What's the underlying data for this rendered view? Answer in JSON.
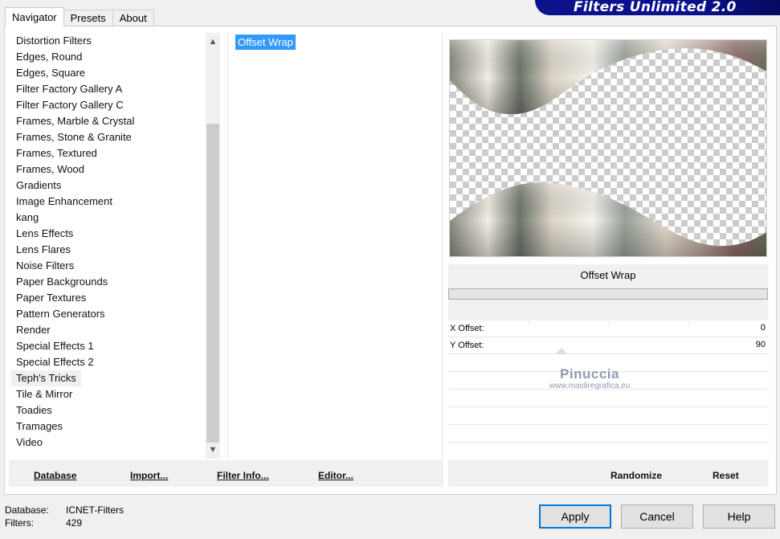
{
  "tabs": [
    "Navigator",
    "Presets",
    "About"
  ],
  "brand": "Filters Unlimited 2.0",
  "categories": [
    "Distortion Filters",
    "Edges, Round",
    "Edges, Square",
    "Filter Factory Gallery A",
    "Filter Factory Gallery C",
    "Frames, Marble & Crystal",
    "Frames, Stone & Granite",
    "Frames, Textured",
    "Frames, Wood",
    "Gradients",
    "Image Enhancement",
    "kang",
    "Lens Effects",
    "Lens Flares",
    "Noise Filters",
    "Paper Backgrounds",
    "Paper Textures",
    "Pattern Generators",
    "Render",
    "Special Effects 1",
    "Special Effects 2",
    "Teph's Tricks",
    "Tile & Mirror",
    "Toadies",
    "Tramages",
    "Video"
  ],
  "selected_category": "Teph's Tricks",
  "filters": [
    "Offset Wrap"
  ],
  "params": {
    "title": "Offset Wrap",
    "x_label": "X Offset:",
    "x_value": "0",
    "y_label": "Y Offset:",
    "y_value": "90"
  },
  "watermark": {
    "line1": "Pinuccia",
    "line2": "www.maidiregrafica.eu"
  },
  "toolbar": {
    "database": "Database",
    "import": "Import...",
    "filter_info": "Filter Info...",
    "editor": "Editor...",
    "randomize": "Randomize",
    "reset": "Reset"
  },
  "status": {
    "database_label": "Database:",
    "database_value": "ICNET-Filters",
    "filters_label": "Filters:",
    "filters_value": "429"
  },
  "buttons": {
    "apply": "Apply",
    "cancel": "Cancel",
    "help": "Help"
  },
  "colors": {
    "brand_bg": "#0b138a",
    "selection": "#3399ff",
    "primary_border": "#0078d7"
  }
}
